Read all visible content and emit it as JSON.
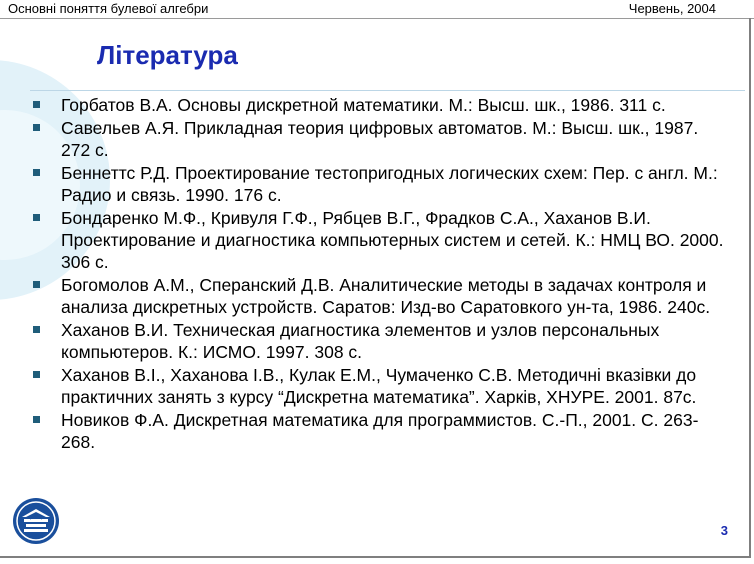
{
  "header": {
    "left_text": "Основні поняття булевої алгебри",
    "right_text": "Червень, 2004"
  },
  "title": "Література",
  "references": [
    "Горбатов В.А. Основы дискретной математики. М.: Высш. шк., 1986. 311 с.",
    "Савельев А.Я. Прикладная теория цифровых автоматов. М.: Высш. шк., 1987. 272 с.",
    "Беннеттс Р.Д. Проектирование тестопригодных логических схем: Пер. с англ. М.: Радио и связь. 1990. 176 с.",
    "Бондаренко М.Ф., Кривуля Г.Ф., Рябцев В.Г., Фрадков С.А., Хаханов В.И. Проектирование и диагностика компьютерных систем и сетей. К.: НМЦ ВО. 2000. 306 с.",
    "Богомолов А.М., Сперанский Д.В. Аналитические методы в задачах контроля и анализа дискретных устройств. Саратов: Изд-во Саратовкого ун-та, 1986. 240с.",
    "Хаханов В.И. Техническая диагностика элементов и узлов персональных компьютеров. К.: ИСМО. 1997. 308 с.",
    "Хаханов В.І., Хаханова І.В., Кулак Е.М., Чумаченко С.В. Методичні вказівки до практичних занять з курсу “Дискретна математика”. Харків, ХНУРЕ. 2001. 87с.",
    "Новиков Ф.А. Дискретная математика для программистов. С.-П., 2001. С. 263-268."
  ],
  "page_number": "3",
  "icons": {
    "logo": "university-logo-icon",
    "bullet": "square-bullet-icon"
  },
  "colors": {
    "title": "#1a2bb0",
    "bullet": "#1f5d7a",
    "logo": "#1a4f9c",
    "decoration": "#e2f2f9"
  }
}
